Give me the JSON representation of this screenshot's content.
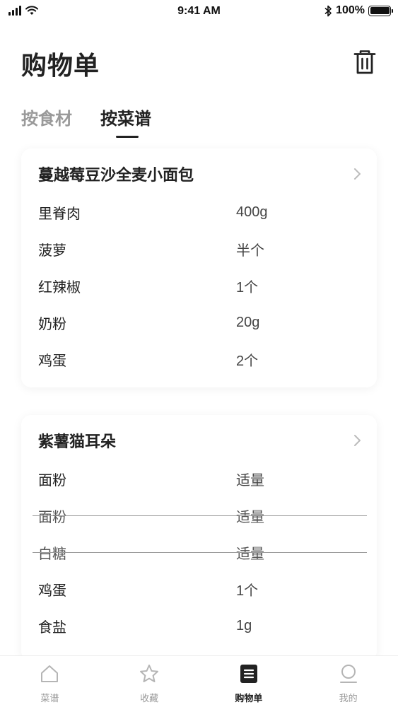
{
  "status": {
    "time": "9:41 AM",
    "battery": "100%",
    "battery_level": 1.0
  },
  "header": {
    "title": "购物单",
    "trash_icon": "trash-icon"
  },
  "tabs": [
    {
      "label": "按食材",
      "active": false
    },
    {
      "label": "按菜谱",
      "active": true
    }
  ],
  "cards": [
    {
      "title": "蔓越莓豆沙全麦小面包",
      "items": [
        {
          "name": "里脊肉",
          "qty": "400g",
          "done": false
        },
        {
          "name": "菠萝",
          "qty": "半个",
          "done": false
        },
        {
          "name": "红辣椒",
          "qty": "1个",
          "done": false
        },
        {
          "name": "奶粉",
          "qty": "20g",
          "done": false
        },
        {
          "name": "鸡蛋",
          "qty": "2个",
          "done": false
        }
      ]
    },
    {
      "title": "紫薯猫耳朵",
      "items": [
        {
          "name": "面粉",
          "qty": "适量",
          "done": false
        },
        {
          "name": "面粉",
          "qty": "适量",
          "done": true
        },
        {
          "name": "白糖",
          "qty": "适量",
          "done": true
        },
        {
          "name": "鸡蛋",
          "qty": "1个",
          "done": false
        },
        {
          "name": "食盐",
          "qty": "1g",
          "done": false
        }
      ]
    }
  ],
  "tabbar": [
    {
      "label": "菜谱",
      "icon": "home-icon",
      "active": false
    },
    {
      "label": "收藏",
      "icon": "star-icon",
      "active": false
    },
    {
      "label": "购物单",
      "icon": "list-icon",
      "active": true
    },
    {
      "label": "我的",
      "icon": "profile-icon",
      "active": false
    }
  ],
  "colors": {
    "text_primary": "#222222",
    "text_inactive": "#9a9a9a",
    "strike": "#9a9a9a"
  }
}
